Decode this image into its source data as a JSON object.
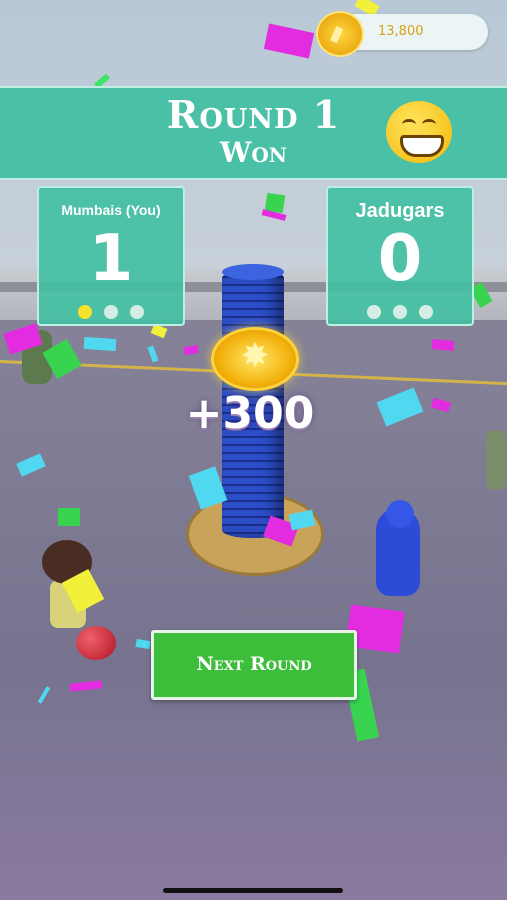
{
  "hud": {
    "coins": "13,800",
    "coin_icon": "coin-icon"
  },
  "banner": {
    "title": "Round 1",
    "result": "Won",
    "emoji": "grinning-face-icon"
  },
  "teams": [
    {
      "name": "Mumbais (You)",
      "score": "1",
      "rounds_won": 1,
      "rounds_total": 3
    },
    {
      "name": "Jadugars",
      "score": "0",
      "rounds_won": 0,
      "rounds_total": 3
    }
  ],
  "reward": {
    "text": "+300"
  },
  "buttons": {
    "next_round": "Next Round"
  },
  "colors": {
    "panel": "#40c0a2",
    "button": "#3cbe3a",
    "active_dot": "#f6e12a",
    "coin_text": "#d7a114"
  }
}
